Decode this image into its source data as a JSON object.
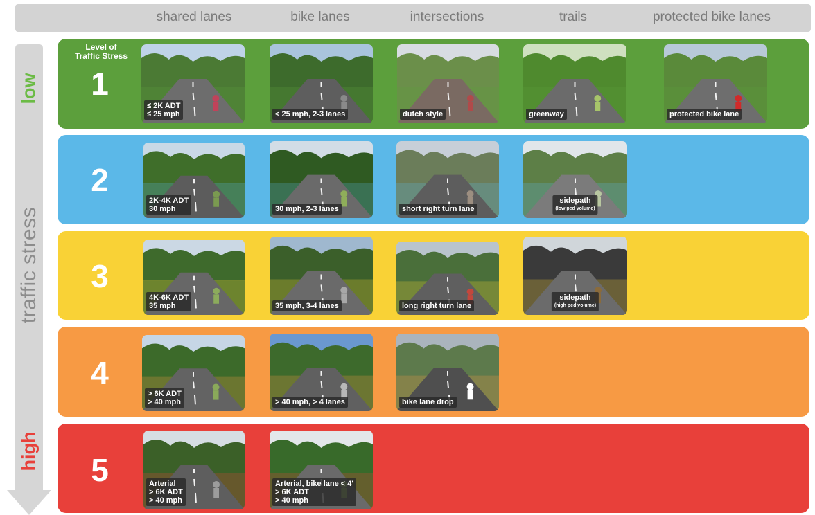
{
  "header": {
    "columns": [
      "shared lanes",
      "bike lanes",
      "intersections",
      "trails",
      "protected bike lanes"
    ]
  },
  "axis": {
    "title": "traffic stress",
    "low": "low",
    "high": "high"
  },
  "legend_title": "Level of\nTraffic Stress",
  "colors": {
    "row1": "#5c9f3c",
    "row2": "#5bb8e8",
    "row3": "#f9d236",
    "row4": "#f79a44",
    "row5": "#e8403a",
    "header": "#d3d3d3",
    "arrow": "#d6d6d6"
  },
  "rows": [
    {
      "level": "1",
      "cells": [
        {
          "caption": "≤ 2K ADT\n≤ 25 mph",
          "scene": "residential-street"
        },
        {
          "caption": "< 25 mph, 2-3 lanes",
          "scene": "bike-lane-road"
        },
        {
          "caption": "dutch style",
          "scene": "dutch-intersection"
        },
        {
          "caption": "greenway",
          "scene": "greenway-trail"
        },
        {
          "caption": "protected bike lane",
          "scene": "protected-lane"
        }
      ]
    },
    {
      "level": "2",
      "cells": [
        {
          "caption": "2K-4K ADT\n30 mph",
          "scene": "rural-road"
        },
        {
          "caption": "30 mph, 2-3 lanes",
          "scene": "suburban-road"
        },
        {
          "caption": "short right turn lane",
          "scene": "turn-lane"
        },
        {
          "caption": "sidepath",
          "sub": "(low ped volume)",
          "scene": "sidepath"
        }
      ]
    },
    {
      "level": "3",
      "cells": [
        {
          "caption": "4K-6K ADT\n35 mph",
          "scene": "arterial-road"
        },
        {
          "caption": "35 mph, 3-4 lanes",
          "scene": "wide-road"
        },
        {
          "caption": "long right turn lane",
          "scene": "cyclists-road"
        },
        {
          "caption": "sidepath",
          "sub": "(high ped volume)",
          "scene": "bridge-path"
        }
      ]
    },
    {
      "level": "4",
      "cells": [
        {
          "caption": "> 6K ADT\n> 40 mph",
          "scene": "highway-shoulder"
        },
        {
          "caption": "> 40 mph, > 4 lanes",
          "scene": "multilane-road"
        },
        {
          "caption": "bike lane drop",
          "scene": "lane-drop"
        }
      ]
    },
    {
      "level": "5",
      "cells": [
        {
          "caption": "Arterial\n> 6K ADT\n> 40 mph",
          "scene": "arterial-intersection"
        },
        {
          "caption": "Arterial, bike lane < 4'\n> 6K ADT\n> 40 mph",
          "scene": "arterial-bike-lane"
        }
      ]
    }
  ]
}
